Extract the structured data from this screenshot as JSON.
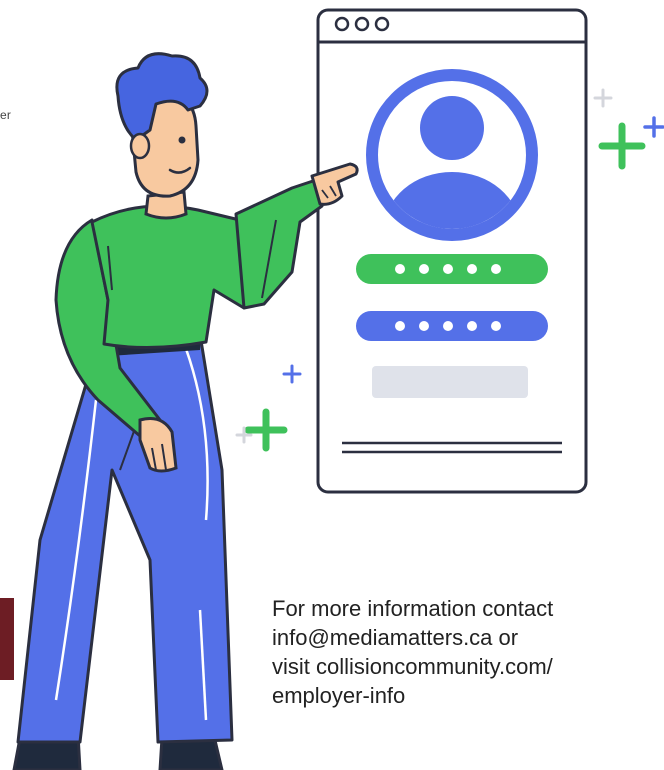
{
  "edge_fragment": "er",
  "contact": {
    "line1": "For more information contact",
    "line2": "info@mediamatters.ca or",
    "line3": "visit collisioncommunity.com/",
    "line4": "employer-info"
  },
  "colors": {
    "green": "#3fc15b",
    "blue": "#5470e8",
    "outline": "#2b2f40",
    "maroon": "#6d1d24",
    "skin": "#f8c9a0",
    "hair": "#4665e0"
  },
  "icons": [
    "window-dots-icon",
    "user-avatar-icon",
    "sparkle-icon"
  ],
  "password_mask": "•••••"
}
